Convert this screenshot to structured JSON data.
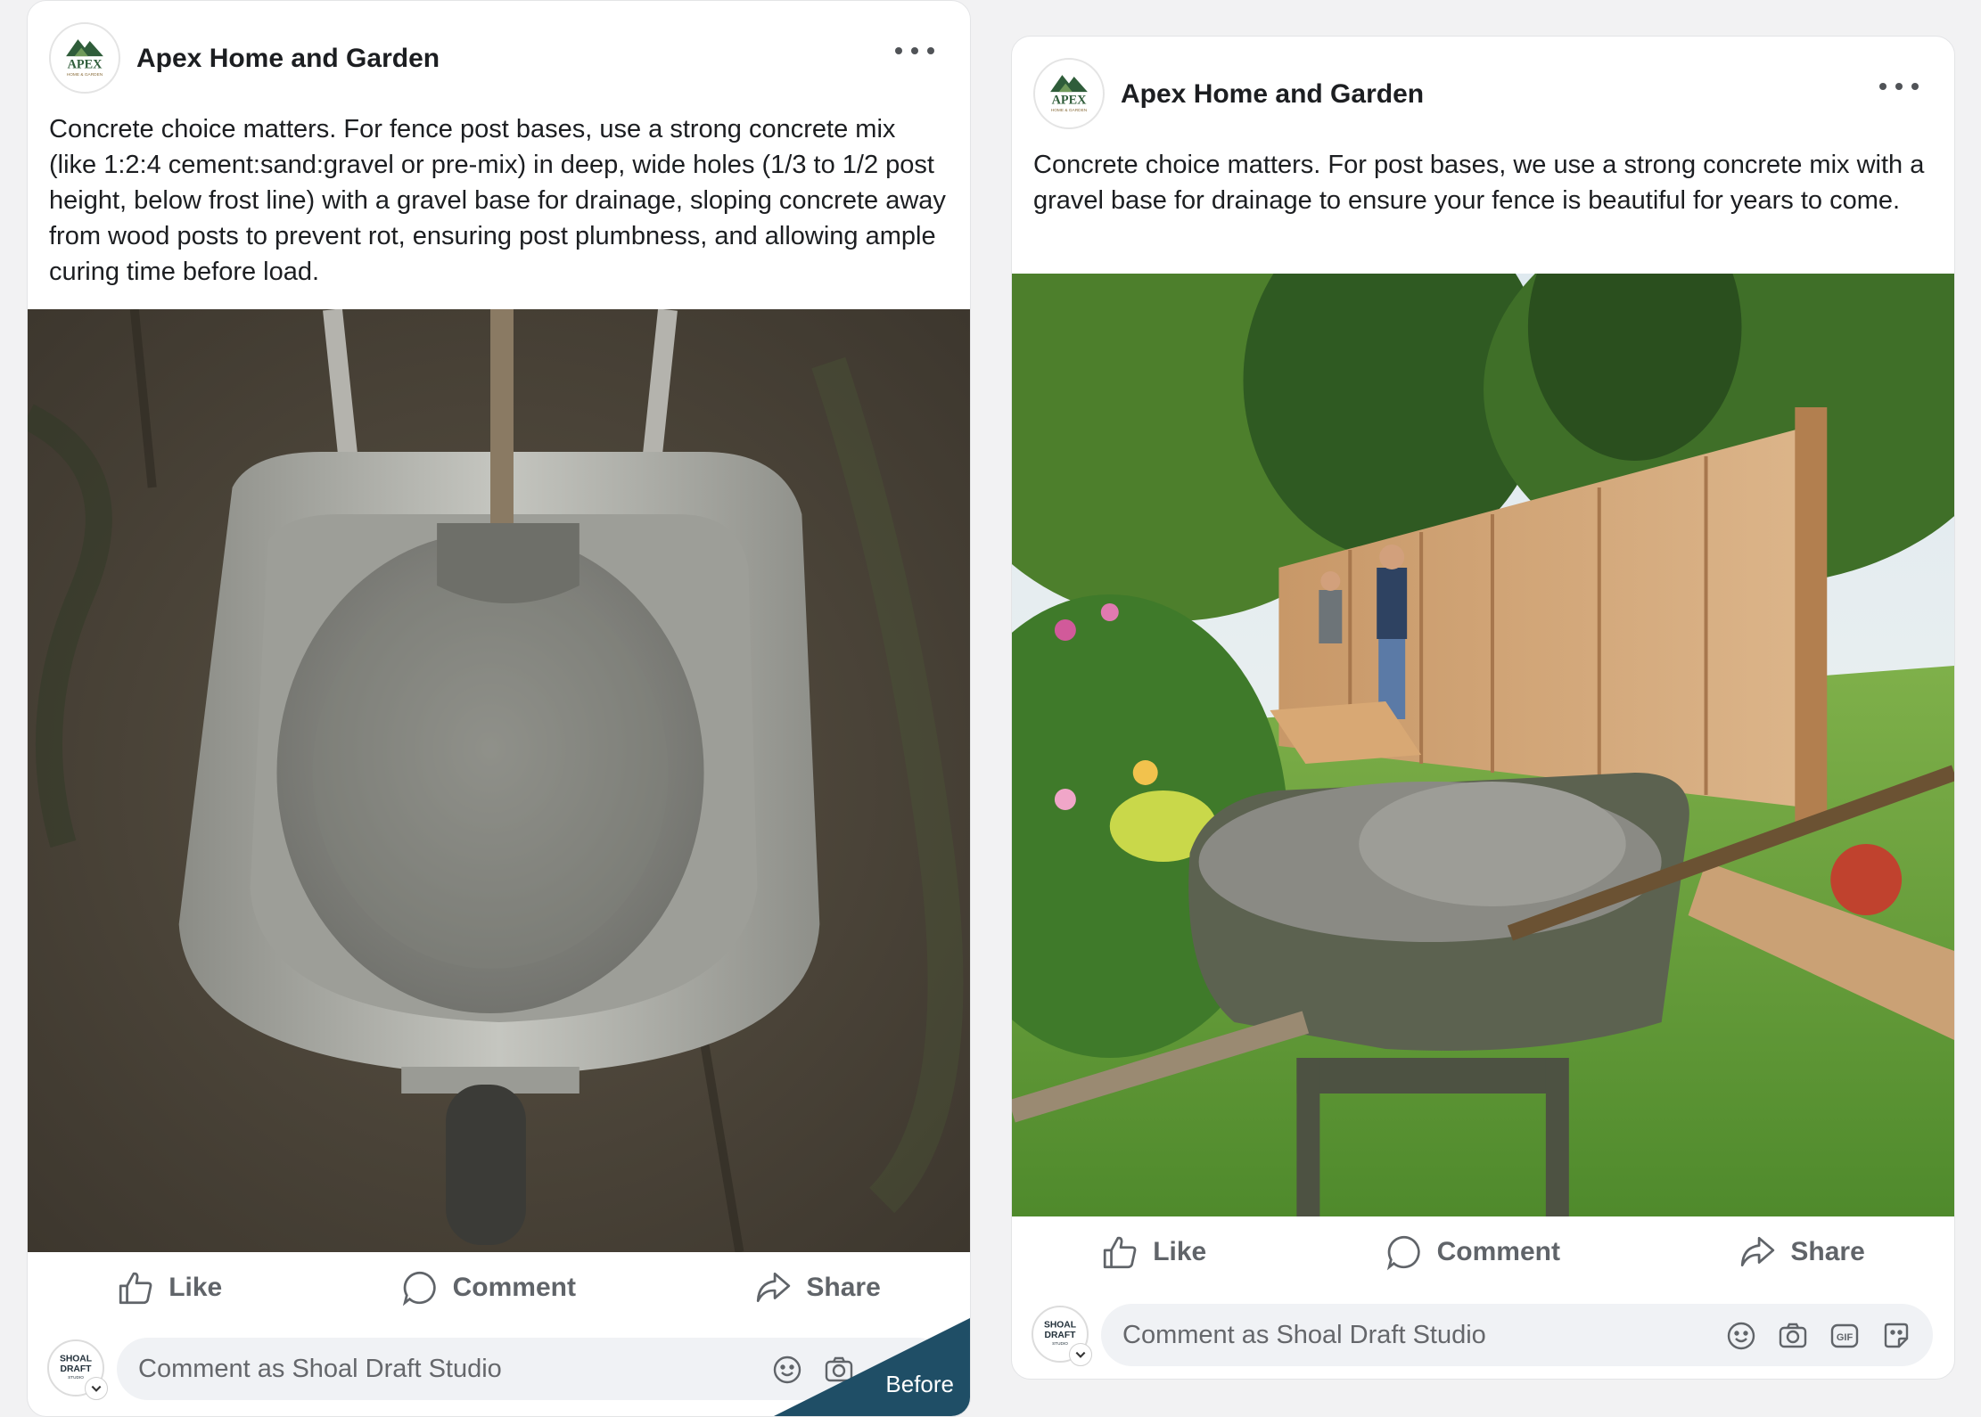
{
  "posts": [
    {
      "page_name": "Apex Home and Garden",
      "logo_text": "APEX",
      "logo_subtext": "HOME & GARDEN",
      "text": "Concrete choice matters. For fence post bases, use a strong concrete mix (like 1:2:4 cement:sand:gravel or pre-mix) in deep, wide holes (1/3 to 1/2 post height, below frost line) with a gravel base for drainage, sloping concrete away from wood posts to prevent rot, ensuring post plumbness, and allowing ample curing time before load.",
      "actions": {
        "like": "Like",
        "comment": "Comment",
        "share": "Share"
      },
      "comment_placeholder": "Comment as Shoal Draft Studio",
      "badge": "Before"
    },
    {
      "page_name": "Apex Home and Garden",
      "logo_text": "APEX",
      "logo_subtext": "HOME & GARDEN",
      "text": "Concrete choice matters. For post bases, we use a strong concrete mix with a gravel base for drainage to ensure your fence is beautiful for years to come.",
      "actions": {
        "like": "Like",
        "comment": "Comment",
        "share": "Share"
      },
      "comment_placeholder": "Comment as Shoal Draft Studio"
    }
  ],
  "commenter": {
    "logo_line1": "SHOAL",
    "logo_line2": "DRAFT",
    "logo_line3": "STUDIO"
  },
  "colors": {
    "brand_green": "#2f5d3a",
    "badge": "#1f4e66",
    "input_bg": "#f0f2f5"
  }
}
